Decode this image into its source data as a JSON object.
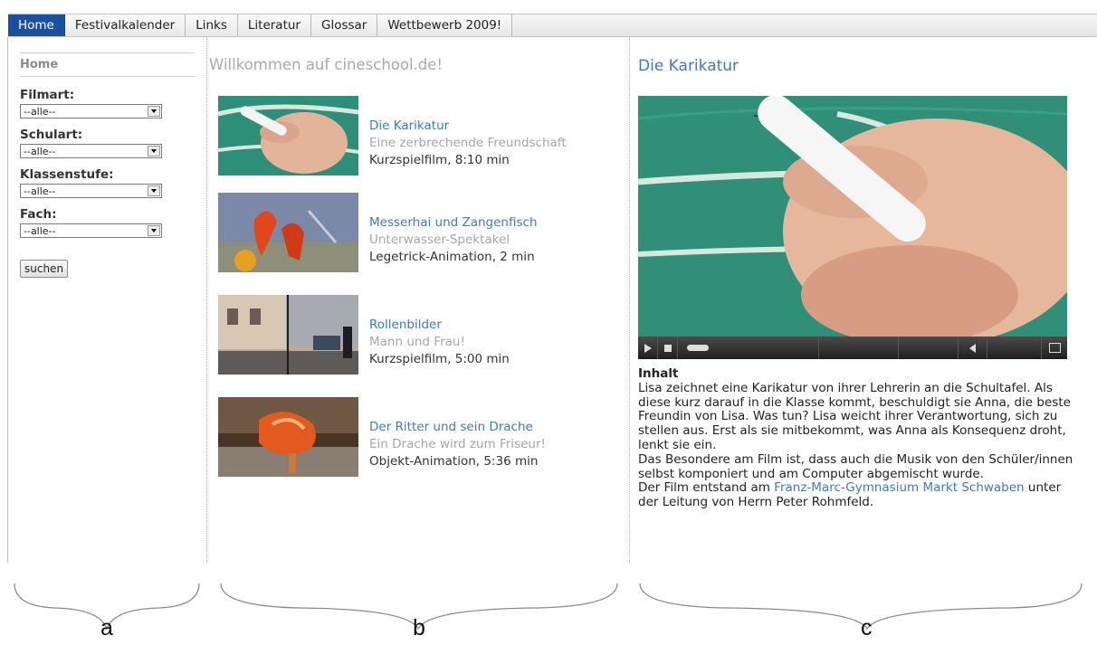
{
  "nav": {
    "tabs": [
      {
        "label": "Home",
        "active": true
      },
      {
        "label": "Festivalkalender",
        "active": false
      },
      {
        "label": "Links",
        "active": false
      },
      {
        "label": "Literatur",
        "active": false
      },
      {
        "label": "Glossar",
        "active": false
      },
      {
        "label": "Wettbewerb 2009!",
        "active": false
      }
    ],
    "active_color": "#1b4fa0"
  },
  "sidebar": {
    "title": "Home",
    "filters": [
      {
        "label": "Filmart:",
        "value": "--alle--"
      },
      {
        "label": "Schulart:",
        "value": "--alle--"
      },
      {
        "label": "Klassenstufe:",
        "value": "--alle--"
      },
      {
        "label": "Fach:",
        "value": "--alle--"
      }
    ],
    "search_label": "suchen"
  },
  "main": {
    "welcome": "Willkommen auf cineschool.de!",
    "films": [
      {
        "title": "Die Karikatur",
        "subtitle": "Eine zerbrechende Freundschaft",
        "meta": "Kurzspielfilm, 8:10 min"
      },
      {
        "title": "Messerhai und Zangenfisch",
        "subtitle": "Unterwasser-Spektakel",
        "meta": "Legetrick-Animation, 2 min"
      },
      {
        "title": "Rollenbilder",
        "subtitle": "Mann und Frau!",
        "meta": "Kurzspielfilm, 5:00 min"
      },
      {
        "title": "Der Ritter und sein Drache",
        "subtitle": "Ein Drache wird zum Friseur!",
        "meta": "Objekt-Animation, 5:36 min"
      }
    ]
  },
  "detail": {
    "title": "Die Karikatur",
    "content_heading": "Inhalt",
    "paragraph1": "Lisa zeichnet eine Karikatur von ihrer Lehrerin an die Schultafel. Als diese kurz darauf in die Klasse kommt, beschuldigt sie Anna, die beste Freundin von Lisa. Was tun? Lisa weicht ihrer Verantwortung, sich zu stellen aus. Erst als sie mitbekommt, was Anna als Konsequenz droht, lenkt sie ein.",
    "paragraph2": "Das Besondere am Film ist, dass auch die Musik von den Schüler/innen selbst komponiert und am Computer abgemischt wurde.",
    "paragraph3_pre": "Der Film entstand am ",
    "paragraph3_link": "Franz-Marc-Gymnasium Markt Schwaben",
    "paragraph3_post": " unter der Leitung von Herrn Peter Rohmfeld.",
    "link_color": "#3d7ac4"
  },
  "annotations": {
    "labels": [
      "a",
      "b",
      "c"
    ]
  }
}
